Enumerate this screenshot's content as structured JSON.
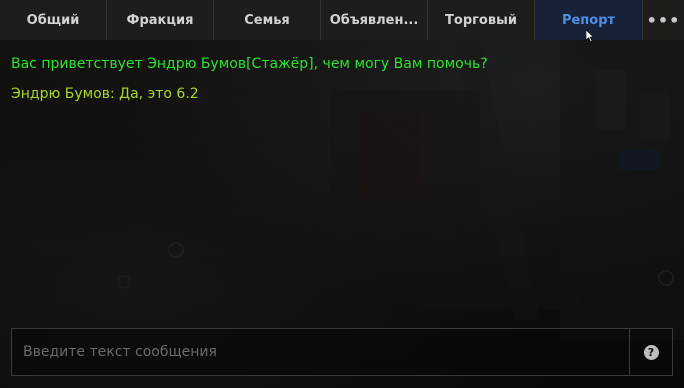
{
  "tabs": [
    {
      "label": "Общий",
      "active": false
    },
    {
      "label": "Фракция",
      "active": false
    },
    {
      "label": "Семья",
      "active": false
    },
    {
      "label": "Объявлен...",
      "active": false
    },
    {
      "label": "Торговый",
      "active": false
    },
    {
      "label": "Репорт",
      "active": true
    }
  ],
  "more_label": "•••",
  "messages": [
    {
      "text": "Вас приветствует Эндрю Бумов[Стажёр], чем могу Вам помочь?",
      "color": "#2ee22e"
    },
    {
      "text": "Эндрю Бумов: Да, это 6.2",
      "color": "#a8d82a"
    }
  ],
  "input": {
    "value": "",
    "placeholder": "Введите текст сообщения"
  },
  "help": {
    "label": "?"
  },
  "colors": {
    "tab_bg": "#1e1d1c",
    "tab_active_bg": "#172137",
    "tab_active_text": "#4f8fe6",
    "tab_text": "#d2d2d2"
  },
  "icons": {
    "more": "more-dots-icon",
    "help": "help-question-icon",
    "cursor": "mouse-cursor-icon"
  }
}
